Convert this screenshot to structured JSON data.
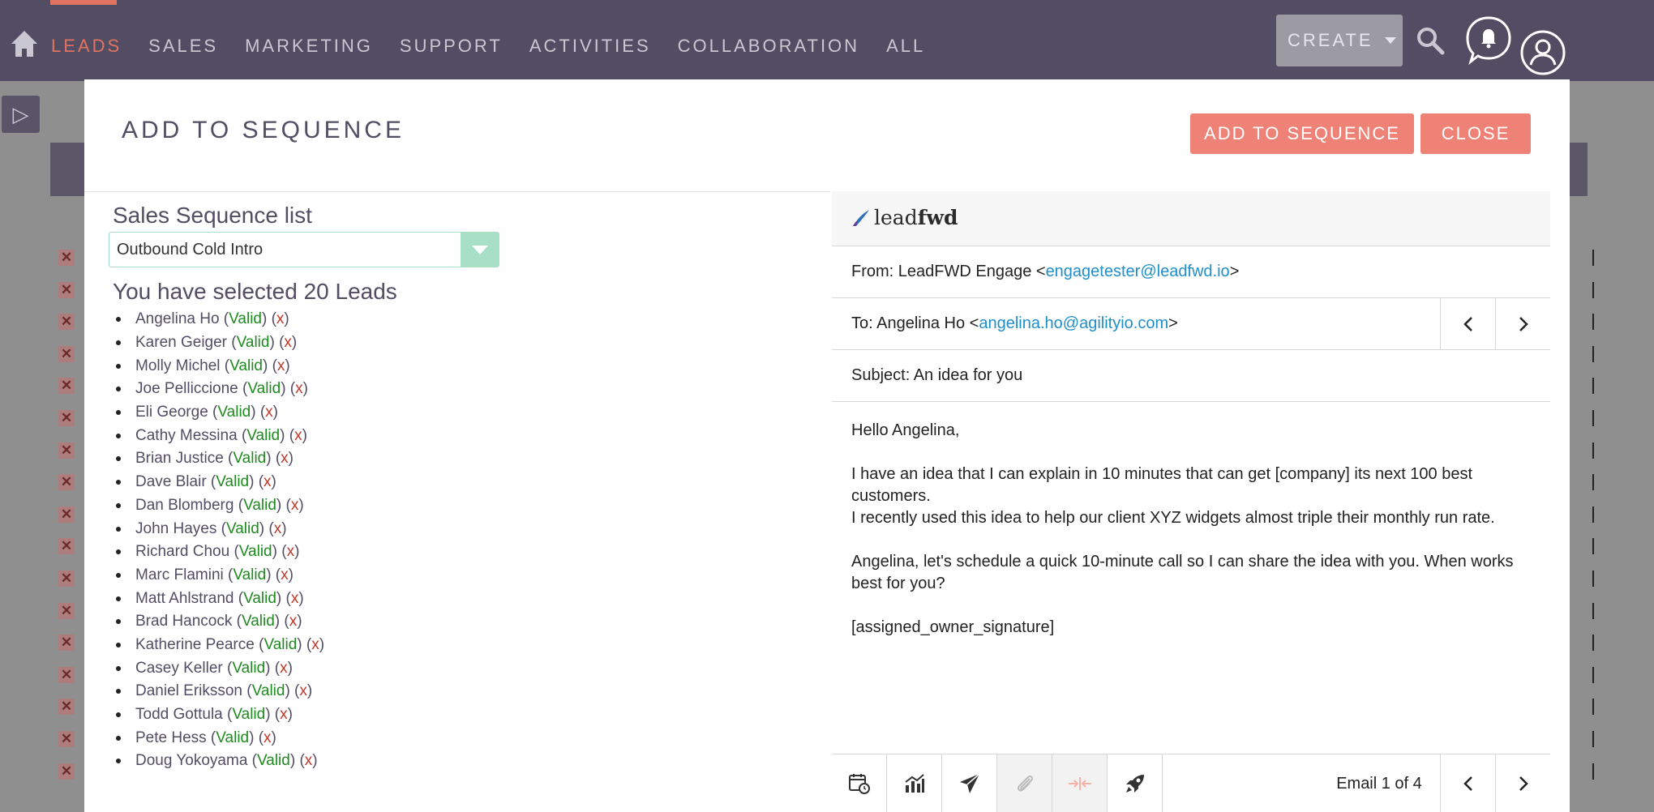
{
  "nav": {
    "items": [
      "LEADS",
      "SALES",
      "MARKETING",
      "SUPPORT",
      "ACTIVITIES",
      "COLLABORATION",
      "ALL"
    ],
    "active": "LEADS",
    "create_label": "CREATE",
    "icons": [
      "home-icon",
      "search-icon",
      "bell-icon",
      "user-icon"
    ]
  },
  "modal": {
    "title": "ADD TO SEQUENCE",
    "add_button": "ADD TO SEQUENCE",
    "close_button": "CLOSE",
    "sequence_label": "Sales Sequence list",
    "sequence_selected": "Outbound Cold Intro",
    "selected_heading": "You have selected 20 Leads",
    "valid_label": "Valid",
    "remove_label": "x",
    "leads": [
      "Angelina Ho",
      "Karen Geiger",
      "Molly Michel",
      "Joe Pelliccione",
      "Eli George",
      "Cathy Messina",
      "Brian Justice",
      "Dave Blair",
      "Dan Blomberg",
      "John Hayes",
      "Richard Chou",
      "Marc Flamini",
      "Matt Ahlstrand",
      "Brad Hancock",
      "Katherine Pearce",
      "Casey Keller",
      "Daniel Eriksson",
      "Todd Gottula",
      "Pete Hess",
      "Doug Yokoyama"
    ]
  },
  "email": {
    "logo_light": "lead",
    "logo_bold": "fwd",
    "from_label": "From: LeadFWD Engage <",
    "from_email": "engagetester@leadfwd.io",
    "to_label": "To: Angelina Ho <",
    "to_email": "angelina.ho@agilityio.com",
    "close_bracket": ">",
    "subject": "Subject: An idea for you",
    "body": {
      "greeting": "Hello Angelina,",
      "p1": "I have an idea that I can explain in 10 minutes that can get [company] its next 100 best customers.",
      "p2": "I recently used this idea to help our client XYZ widgets almost triple their monthly run rate.",
      "p3": "Angelina, let's schedule a quick 10-minute call so I can share the idea with you. When works best for you?",
      "signature": "[assigned_owner_signature]"
    },
    "counter": "Email 1 of 4",
    "prev": "‹",
    "next": "›"
  },
  "colors": {
    "nav_bg": "#534d64",
    "accent": "#e0735f",
    "button": "#ef8276",
    "valid": "#1f8a1f",
    "link": "#1f8fc9",
    "select_accent": "#a8dfc7"
  }
}
